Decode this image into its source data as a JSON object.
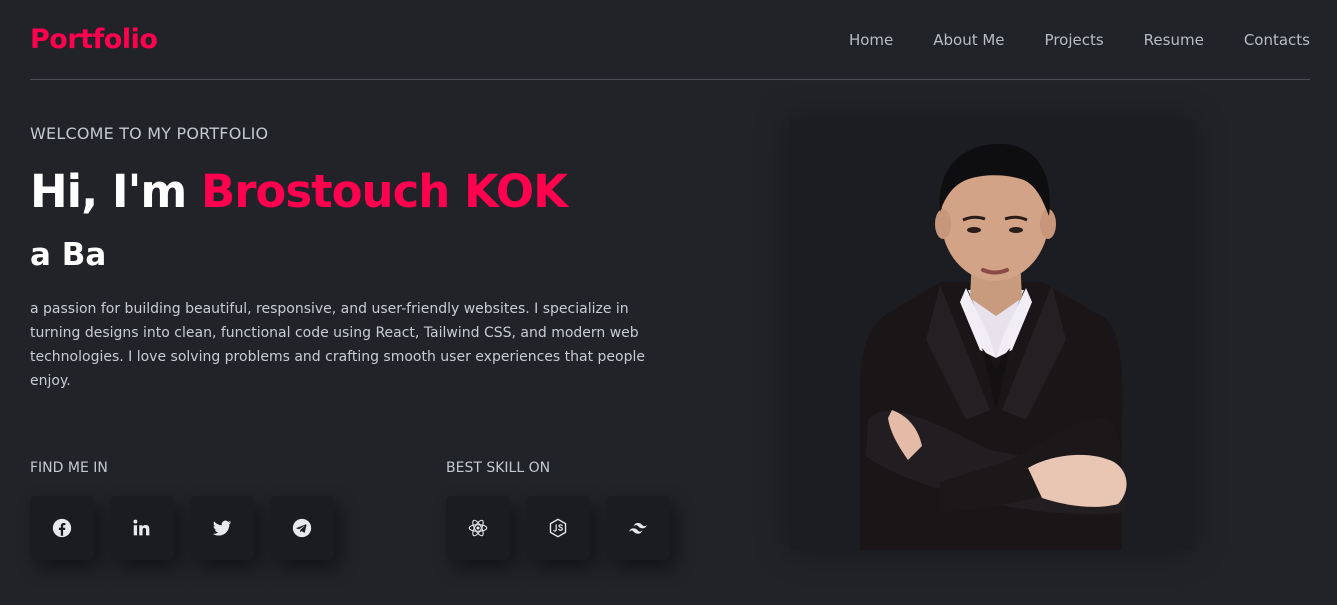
{
  "header": {
    "logo": "Portfolio",
    "nav": [
      "Home",
      "About Me",
      "Projects",
      "Resume",
      "Contacts"
    ]
  },
  "hero": {
    "welcome": "WELCOME TO MY PORTFOLIO",
    "greeting": "Hi, I'm ",
    "name": "Brostouch KOK",
    "role": "a Ba",
    "description": "a passion for building beautiful, responsive, and user-friendly websites. I specialize in turning designs into clean, functional code using React, Tailwind CSS, and modern web technologies. I love solving problems and crafting smooth user experiences that people enjoy."
  },
  "social": {
    "label": "FIND ME IN",
    "icons": [
      "facebook-icon",
      "linkedin-icon",
      "twitter-icon",
      "telegram-icon"
    ]
  },
  "skills": {
    "label": "BEST SKILL ON",
    "icons": [
      "react-icon",
      "nodejs-icon",
      "tailwind-icon"
    ]
  },
  "colors": {
    "accent": "#ff014f",
    "background": "#212328",
    "card": "#1b1c20"
  }
}
